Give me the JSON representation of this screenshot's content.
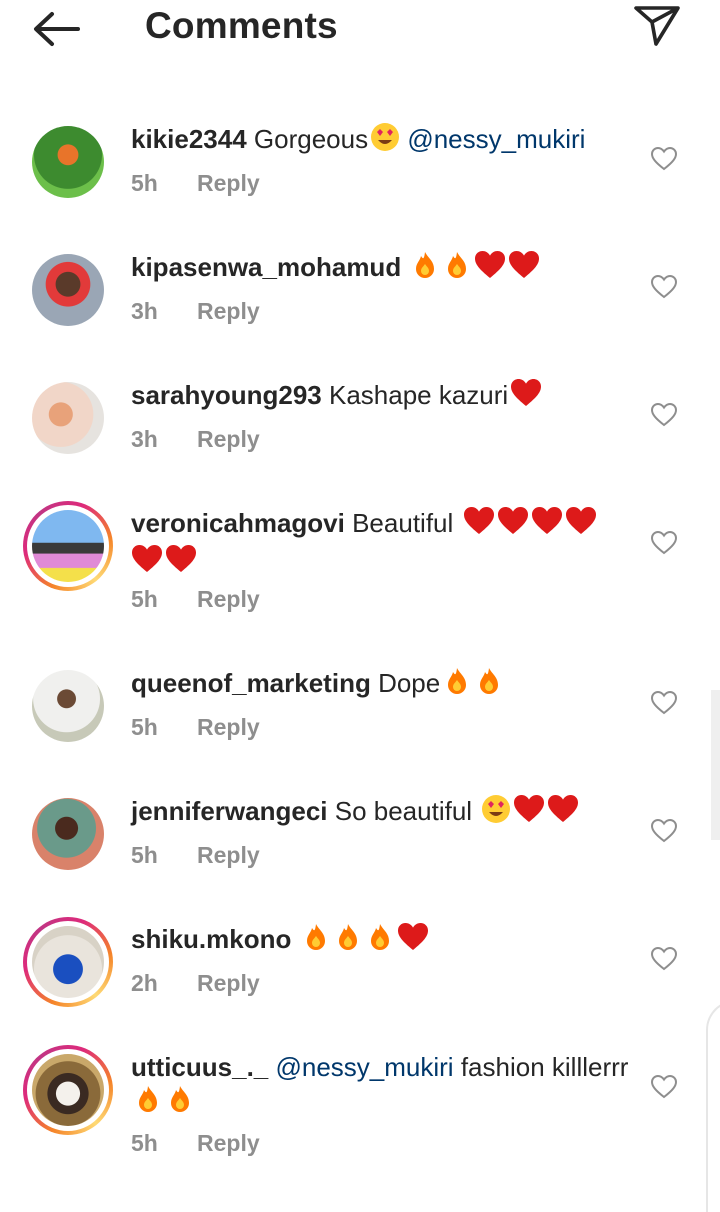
{
  "header": {
    "title": "Comments"
  },
  "comments": [
    {
      "user": "kikie2344",
      "text": "Gorgeous",
      "emoji": [
        "heart-eyes"
      ],
      "mention": "@nessy_mukiri",
      "time": "5h",
      "reply": "Reply"
    },
    {
      "user": "kipasenwa_mohamud",
      "text": "",
      "emoji": [
        "fire",
        "fire",
        "heart",
        "heart"
      ],
      "time": "3h",
      "reply": "Reply"
    },
    {
      "user": "sarahyoung293",
      "text": "Kashape kazuri",
      "emoji": [
        "heart"
      ],
      "time": "3h",
      "reply": "Reply"
    },
    {
      "user": "veronicahmagovi",
      "text": "Beautiful",
      "emoji": [
        "heart",
        "heart",
        "heart",
        "heart",
        "heart",
        "heart"
      ],
      "time": "5h",
      "reply": "Reply"
    },
    {
      "user": "queenof_marketing",
      "text": "Dope",
      "emoji": [
        "fire",
        "fire"
      ],
      "time": "5h",
      "reply": "Reply"
    },
    {
      "user": "jenniferwangeci",
      "text": "So beautiful",
      "emoji": [
        "heart-eyes",
        "heart",
        "heart"
      ],
      "time": "5h",
      "reply": "Reply"
    },
    {
      "user": "shiku.mkono",
      "text": "",
      "emoji": [
        "fire",
        "fire",
        "fire",
        "heart"
      ],
      "time": "2h",
      "reply": "Reply"
    },
    {
      "user": "utticuus_._",
      "mention": "@nessy_mukiri",
      "text": "fashion killlerrr",
      "emoji": [
        "fire",
        "fire"
      ],
      "time": "5h",
      "reply": "Reply"
    }
  ],
  "colors": {
    "username": "#262626",
    "mention": "#00376b",
    "meta": "#8e8e8e",
    "heart": "#ed4956",
    "fire": "#ff7a00"
  }
}
